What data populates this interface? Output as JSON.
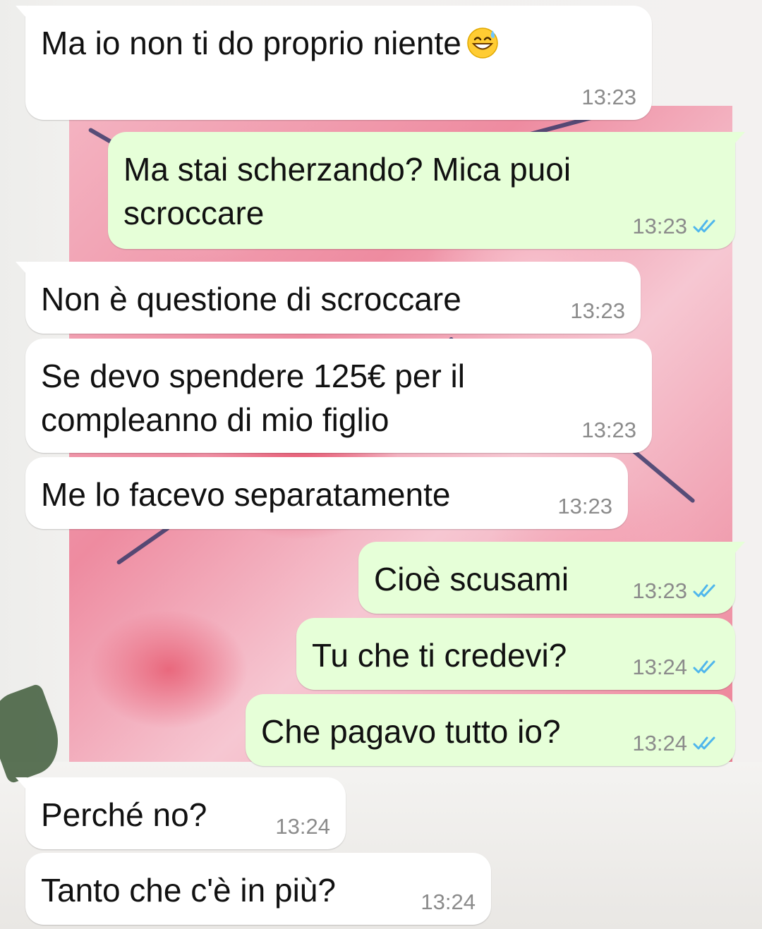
{
  "colors": {
    "incoming_bubble": "#ffffff",
    "outgoing_bubble": "#e6ffd8",
    "text": "#111111",
    "time": "#8b8b8b",
    "read_ticks": "#4fb6ec"
  },
  "messages": [
    {
      "direction": "in",
      "text": "Ma io non ti do proprio niente",
      "emoji": "grinning-sweat-emoji",
      "time": "13:23"
    },
    {
      "direction": "out",
      "text": "Ma stai scherzando? Mica puoi\nscroccare",
      "time": "13:23",
      "status": "read"
    },
    {
      "direction": "in",
      "text": "Non è questione di scroccare",
      "time": "13:23"
    },
    {
      "direction": "in",
      "text": "Se devo spendere 125€ per il\ncompleanno di mio figlio",
      "time": "13:23"
    },
    {
      "direction": "in",
      "text": "Me lo facevo separatamente",
      "time": "13:23"
    },
    {
      "direction": "out",
      "text": "Cioè scusami",
      "time": "13:23",
      "status": "read"
    },
    {
      "direction": "out",
      "text": "Tu che ti credevi?",
      "time": "13:24",
      "status": "read"
    },
    {
      "direction": "out",
      "text": "Che pagavo tutto io?",
      "time": "13:24",
      "status": "read"
    },
    {
      "direction": "in",
      "text": "Perché no?",
      "time": "13:24"
    },
    {
      "direction": "in",
      "text": "Tanto che c'è in più?",
      "time": "13:24"
    }
  ]
}
